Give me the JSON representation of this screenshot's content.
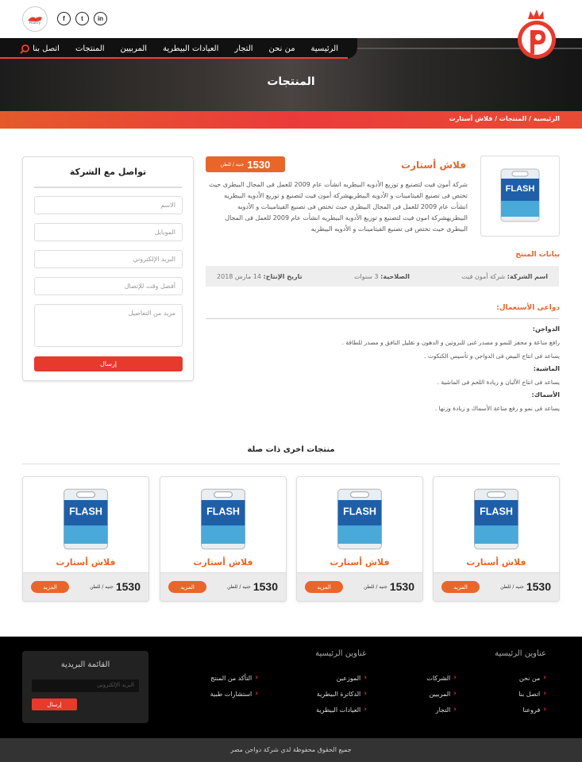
{
  "header": {
    "social": [
      {
        "icon": "linkedin-icon",
        "glyph": "in"
      },
      {
        "icon": "twitter-icon",
        "glyph": "t"
      },
      {
        "icon": "facebook-icon",
        "glyph": "f"
      }
    ],
    "logo_small_text": "Poultry"
  },
  "nav": {
    "items": [
      "الرئيسية",
      "من نحن",
      "التجار",
      "العيادات البيطرية",
      "المربيين",
      "المنتجات",
      "اتصل بنا"
    ]
  },
  "hero": {
    "title": "المنتجات"
  },
  "breadcrumb": "الرئيسية / المنتجات / فلاش أستارت",
  "product": {
    "name": "فلاش أستارت",
    "price": "1530",
    "unit": "جنيه / للطن",
    "description": "شركة أمون فيت لتصنيع و توزيع الأدويه البيطريه انشأت عام 2009 للعمل فى المجال البيطرى حيث تختص فى تصنيع الفيتامينات و الأدويه البيطريهشركة أمون فيت لتصنيع و توزيع الأدويه البيطريه انشأت عام 2009 للعمل فى المجال البيطرى حيث تختص فى تصنيع الفيتامينات و الأدويه البيطريهشركة امون فيت لتصنيع و توزيع الأدويه البيطريه انشأت عام 2009 للعمل فى المجال البيطرى حيث تختص فى تصنيع الفيتامينات و الأدويه البيطريه",
    "image_label": "FLASH",
    "data_title": "بيانات المنتج",
    "specs": {
      "company_label": "اسم الشركة:",
      "company_value": "شركة أمون فيت",
      "validity_label": "الصلاحية:",
      "validity_value": "3 سنوات",
      "date_label": "تاريخ الإنتاج:",
      "date_value": "14 مارس 2018"
    },
    "uses_title": "دواعى الأستعمال:",
    "uses": {
      "poultry_h": "الدواجن:",
      "poultry_1": "رافع مناعة و محفز للنمو و مصدر غنى للبروتين و الدهون و تقليل النافق و مصدر للطاقة .",
      "poultry_2": "يساعد فى انتاج البيض فى الدواجن و تأسيس الكتكوت .",
      "cattle_h": "الماشية:",
      "cattle_1": "يساعد فى انتاج الألبان و زيادة اللحم فى الماشية .",
      "fish_h": "الأسماك:",
      "fish_1": "يساعد فى نمو و رفع مناعة الأسماك و زيادة وزنها ."
    }
  },
  "contact": {
    "title": "تواصل مع الشركة",
    "name_ph": "الاسم",
    "mobile_ph": "الموبايل",
    "email_ph": "البريد الإلكتروني",
    "time_ph": "أفضل وقت للإتصال",
    "details_ph": "مزيد من التفاصيل",
    "submit": "إرسال"
  },
  "related": {
    "title": "منتجات اخرى ذات صلة",
    "cards": [
      {
        "name": "فلاش أستارت",
        "price": "1530",
        "unit": "جنيه / للطن",
        "more": "المزيد"
      },
      {
        "name": "فلاش أستارت",
        "price": "1530",
        "unit": "جنيه / للطن",
        "more": "المزيد"
      },
      {
        "name": "فلاش أستارت",
        "price": "1530",
        "unit": "جنيه / للطن",
        "more": "المزيد"
      },
      {
        "name": "فلاش أستارت",
        "price": "1530",
        "unit": "جنيه / للطن",
        "more": "المزيد"
      }
    ]
  },
  "footer": {
    "col1_title": "عناوين الرئيسية",
    "col2_title": "عناوين الرئيسية",
    "col1": [
      "من نحن",
      "اتصل بنا",
      "فروعنا"
    ],
    "col2": [
      "الشركات",
      "المربيين",
      "التجار"
    ],
    "col3": [
      "الموزعين",
      "الدكاترة البيطرية",
      "العيادات البيطرية"
    ],
    "col4": [
      "التأكد من المنتج",
      "استشارات طبية"
    ],
    "newsletter_title": "القائمة البريدية",
    "newsletter_ph": "البريد الإلكتروني",
    "newsletter_btn": "إرسال",
    "copyright": "جميع الحقوق محفوظة لدي شركة دواجن مصر"
  },
  "colors": {
    "accent": "#e8662a",
    "red": "#e8392d",
    "dark": "#111111"
  }
}
